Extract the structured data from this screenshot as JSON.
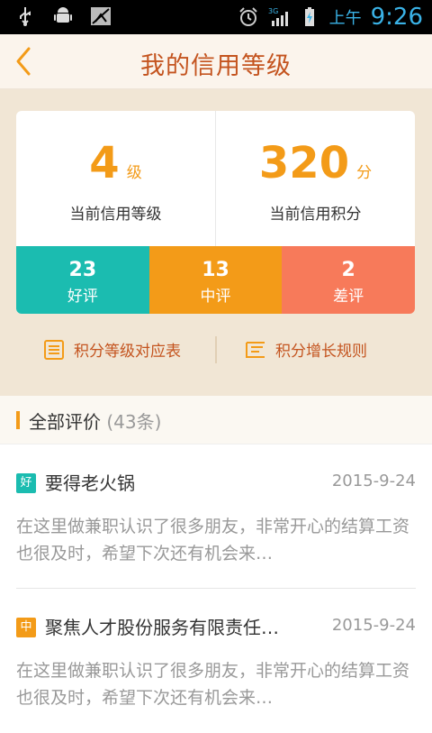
{
  "statusbar": {
    "ampm": "上午",
    "time": "9:26",
    "network": "3G"
  },
  "header": {
    "title": "我的信用等级"
  },
  "summary": {
    "level_value": "4",
    "level_unit": "级",
    "level_label": "当前信用等级",
    "points_value": "320",
    "points_unit": "分",
    "points_label": "当前信用积分",
    "ratings": [
      {
        "count": "23",
        "label": "好评",
        "color": "#1bbcb0"
      },
      {
        "count": "13",
        "label": "中评",
        "color": "#f39b18"
      },
      {
        "count": "2",
        "label": "差评",
        "color": "#f77a5a"
      }
    ],
    "links": [
      {
        "label": "积分等级对应表",
        "icon": "list-table-icon"
      },
      {
        "label": "积分增长规则",
        "icon": "rules-icon"
      }
    ]
  },
  "reviews_section": {
    "title": "全部评价",
    "count": "(43条)",
    "items": [
      {
        "badge": "好",
        "badge_color": "#1bbcb0",
        "company": "要得老火锅",
        "date": "2015-9-24",
        "content": "在这里做兼职认识了很多朋友，非常开心的结算工资也很及时，希望下次还有机会来…"
      },
      {
        "badge": "中",
        "badge_color": "#f39b18",
        "company": "聚焦人才股份服务有限责任…",
        "date": "2015-9-24",
        "content": "在这里做兼职认识了很多朋友，非常开心的结算工资也很及时，希望下次还有机会来…"
      }
    ]
  },
  "colors": {
    "accent": "#f39b18",
    "brand": "#c4541f"
  }
}
